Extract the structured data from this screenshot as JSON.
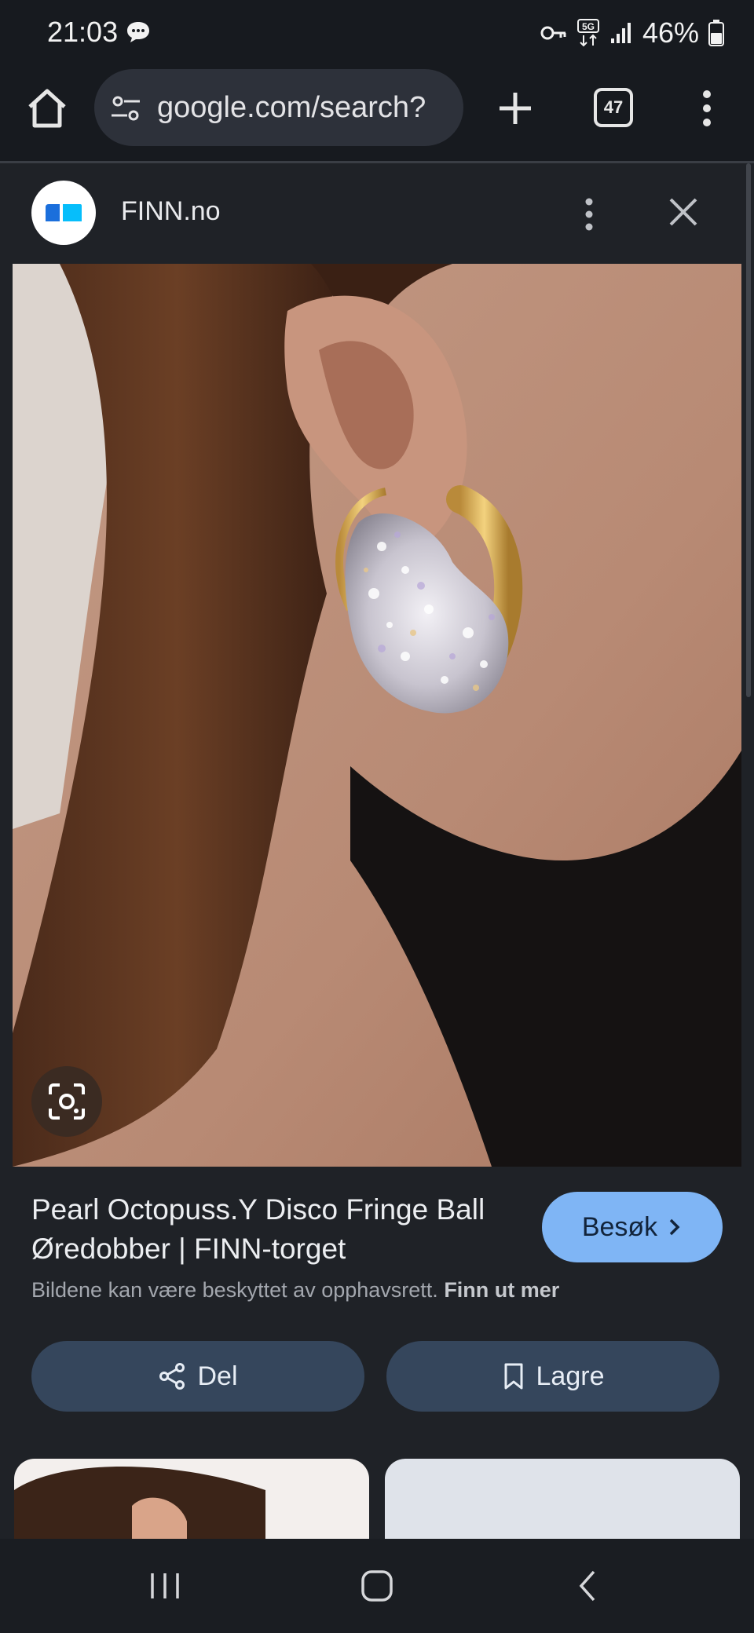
{
  "status_bar": {
    "time": "21:03",
    "battery_percent": "46%",
    "network": "5G"
  },
  "browser": {
    "url": "google.com/search?",
    "tab_count": "47"
  },
  "source": {
    "name": "FINN.no"
  },
  "result": {
    "title": "Pearl Octopuss.Y Disco Fringe Ball Øredobber | FINN-torget",
    "visit_label": "Besøk",
    "copyright_text": "Bildene kan være beskyttet av opphavsrett.",
    "copyright_link": "Finn ut mer"
  },
  "actions": {
    "share_label": "Del",
    "save_label": "Lagre"
  },
  "colors": {
    "accent": "#7fb5f5",
    "action_bg": "#35465c",
    "background": "#1f2227"
  },
  "icons": [
    "chat-icon",
    "key-icon",
    "signal-icon",
    "battery-icon",
    "home-icon",
    "tune-icon",
    "plus-icon",
    "tabs-icon",
    "more-vert-icon",
    "close-icon",
    "lens-icon",
    "chevron-right-icon",
    "share-icon",
    "bookmark-icon",
    "nav-recents-icon",
    "nav-home-icon",
    "nav-back-icon"
  ]
}
